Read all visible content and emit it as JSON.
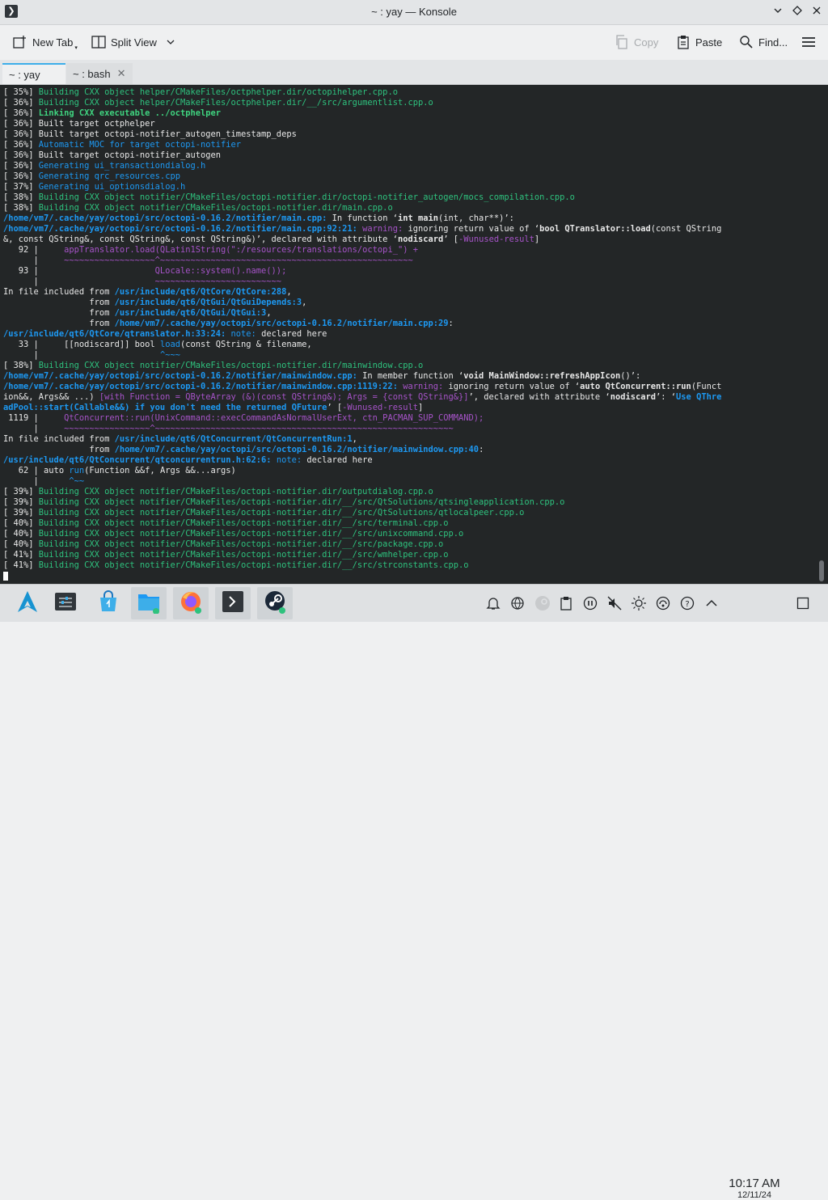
{
  "window": {
    "title": "~ : yay — Konsole"
  },
  "toolbar": {
    "new_tab": "New Tab",
    "split_view": "Split View",
    "copy": "Copy",
    "paste": "Paste",
    "find": "Find..."
  },
  "tabs": [
    {
      "label": "~ : yay",
      "active": true
    },
    {
      "label": "~ : bash",
      "active": false
    }
  ],
  "colors": {
    "terminal_bg": "#232627",
    "green": "#2ec27e",
    "bold_green": "#3fd37f",
    "blue": "#1d99f3",
    "purple": "#a653c8",
    "yellow": "#fdbc4b",
    "white": "#e8e8e8",
    "accent": "#3daee9"
  },
  "terminal": {
    "lines": [
      [
        [
          "[ 35%] ",
          "w"
        ],
        [
          "Building CXX object helper/CMakeFiles/octphelper.dir/octopihelper.cpp.o",
          "g"
        ]
      ],
      [
        [
          "[ 36%] ",
          "w"
        ],
        [
          "Building CXX object helper/CMakeFiles/octphelper.dir/__/src/argumentlist.cpp.o",
          "g"
        ]
      ],
      [
        [
          "[ 36%] ",
          "w"
        ],
        [
          "Linking CXX executable ../octphelper",
          "G"
        ]
      ],
      [
        [
          "[ 36%] Built target octphelper",
          "w"
        ]
      ],
      [
        [
          "[ 36%] Built target octopi-notifier_autogen_timestamp_deps",
          "w"
        ]
      ],
      [
        [
          "[ 36%] ",
          "w"
        ],
        [
          "Automatic MOC for target octopi-notifier",
          "b"
        ]
      ],
      [
        [
          "[ 36%] Built target octopi-notifier_autogen",
          "w"
        ]
      ],
      [
        [
          "[ 36%] ",
          "w"
        ],
        [
          "Generating ui_transactiondialog.h",
          "b"
        ]
      ],
      [
        [
          "[ 36%] ",
          "w"
        ],
        [
          "Generating qrc_resources.cpp",
          "b"
        ]
      ],
      [
        [
          "[ 37%] ",
          "w"
        ],
        [
          "Generating ui_optionsdialog.h",
          "b"
        ]
      ],
      [
        [
          "[ 38%] ",
          "w"
        ],
        [
          "Building CXX object notifier/CMakeFiles/octopi-notifier.dir/octopi-notifier_autogen/mocs_compilation.cpp.o",
          "g"
        ]
      ],
      [
        [
          "[ 38%] ",
          "w"
        ],
        [
          "Building CXX object notifier/CMakeFiles/octopi-notifier.dir/main.cpp.o",
          "g"
        ]
      ],
      [
        [
          "/home/vm7/.cache/yay/octopi/src/octopi-0.16.2/notifier/main.cpp:",
          "B"
        ],
        [
          " In function ‘",
          "w"
        ],
        [
          "int main",
          "W"
        ],
        [
          "(int, char**)’:",
          "w"
        ]
      ],
      [
        [
          "/home/vm7/.cache/yay/octopi/src/octopi-0.16.2/notifier/main.cpp:92:21: ",
          "B"
        ],
        [
          "warning: ",
          "p"
        ],
        [
          "ignoring return value of ‘",
          "w"
        ],
        [
          "bool QTranslator::load",
          "W"
        ],
        [
          "(const QString",
          "w"
        ]
      ],
      [
        [
          "&, const QString&, const QString&, const QString&)’, declared with attribute ‘",
          "w"
        ],
        [
          "nodiscard",
          "W"
        ],
        [
          "’ [",
          "w"
        ],
        [
          "-Wunused-result",
          "p"
        ],
        [
          "]",
          "w"
        ]
      ],
      [
        [
          "   92 |     ",
          "w"
        ],
        [
          "appTranslator.load(QLatin1String(\":/resources/translations/octopi_\") +",
          "p"
        ]
      ],
      [
        [
          "      |     ",
          "w"
        ],
        [
          "~~~~~~~~~~~~~~~~~~^~~~~~~~~~~~~~~~~~~~~~~~~~~~~~~~~~~~~~~~~~~~~~~~~~~",
          "p"
        ]
      ],
      [
        [
          "   93 |                       ",
          "w"
        ],
        [
          "QLocale::system().name());",
          "p"
        ]
      ],
      [
        [
          "      |                       ",
          "w"
        ],
        [
          "~~~~~~~~~~~~~~~~~~~~~~~~~",
          "p"
        ]
      ],
      [
        [
          "In file included from ",
          "w"
        ],
        [
          "/usr/include/qt6/QtCore/QtCore:288",
          "B"
        ],
        [
          ",",
          "w"
        ]
      ],
      [
        [
          "                 from ",
          "w"
        ],
        [
          "/usr/include/qt6/QtGui/QtGuiDepends:3",
          "B"
        ],
        [
          ",",
          "w"
        ]
      ],
      [
        [
          "                 from ",
          "w"
        ],
        [
          "/usr/include/qt6/QtGui/QtGui:3",
          "B"
        ],
        [
          ",",
          "w"
        ]
      ],
      [
        [
          "                 from ",
          "w"
        ],
        [
          "/home/vm7/.cache/yay/octopi/src/octopi-0.16.2/notifier/main.cpp:29",
          "B"
        ],
        [
          ":",
          "w"
        ]
      ],
      [
        [
          "/usr/include/qt6/QtCore/qtranslator.h:33:24: ",
          "B"
        ],
        [
          "note: ",
          "b"
        ],
        [
          "declared here",
          "w"
        ]
      ],
      [
        [
          "   33 |     [[nodiscard]] bool ",
          "w"
        ],
        [
          "load",
          "b"
        ],
        [
          "(const QString & filename,",
          "w"
        ]
      ],
      [
        [
          "      |                        ",
          "w"
        ],
        [
          "^~~~",
          "b"
        ]
      ],
      [
        [
          "[ 38%] ",
          "w"
        ],
        [
          "Building CXX object notifier/CMakeFiles/octopi-notifier.dir/mainwindow.cpp.o",
          "g"
        ]
      ],
      [
        [
          "/home/vm7/.cache/yay/octopi/src/octopi-0.16.2/notifier/mainwindow.cpp:",
          "B"
        ],
        [
          " In member function ‘",
          "w"
        ],
        [
          "void MainWindow::refreshAppIcon",
          "W"
        ],
        [
          "()’:",
          "w"
        ]
      ],
      [
        [
          "/home/vm7/.cache/yay/octopi/src/octopi-0.16.2/notifier/mainwindow.cpp:1119:22: ",
          "B"
        ],
        [
          "warning: ",
          "p"
        ],
        [
          "ignoring return value of ‘",
          "w"
        ],
        [
          "auto QtConcurrent::run",
          "W"
        ],
        [
          "(Funct",
          "w"
        ]
      ],
      [
        [
          "ion&&, Args&& ...) ",
          "w"
        ],
        [
          "[with Function = QByteArray (&)(const QString&); Args = {const QString&}]",
          "p"
        ],
        [
          "’, declared with attribute ‘",
          "w"
        ],
        [
          "nodiscard",
          "W"
        ],
        [
          "’: ‘",
          "w"
        ],
        [
          "Use QThre",
          "B"
        ]
      ],
      [
        [
          "adPool::start(Callable&&) if you don't need the returned QFuture",
          "B"
        ],
        [
          "’ [",
          "w"
        ],
        [
          "-Wunused-result",
          "p"
        ],
        [
          "]",
          "w"
        ]
      ],
      [
        [
          " 1119 |     ",
          "w"
        ],
        [
          "QtConcurrent::run(UnixCommand::execCommandAsNormalUserExt, ctn_PACMAN_SUP_COMMAND);",
          "p"
        ]
      ],
      [
        [
          "      |     ",
          "w"
        ],
        [
          "~~~~~~~~~~~~~~~~~^~~~~~~~~~~~~~~~~~~~~~~~~~~~~~~~~~~~~~~~~~~~~~~~~~~~~~~~~~~~",
          "p"
        ]
      ],
      [
        [
          "In file included from ",
          "w"
        ],
        [
          "/usr/include/qt6/QtConcurrent/QtConcurrentRun:1",
          "B"
        ],
        [
          ",",
          "w"
        ]
      ],
      [
        [
          "                 from ",
          "w"
        ],
        [
          "/home/vm7/.cache/yay/octopi/src/octopi-0.16.2/notifier/mainwindow.cpp:40",
          "B"
        ],
        [
          ":",
          "w"
        ]
      ],
      [
        [
          "/usr/include/qt6/QtConcurrent/qtconcurrentrun.h:62:6: ",
          "B"
        ],
        [
          "note: ",
          "b"
        ],
        [
          "declared here",
          "w"
        ]
      ],
      [
        [
          "   62 | auto ",
          "w"
        ],
        [
          "run",
          "b"
        ],
        [
          "(Function &&f, Args &&...args)",
          "w"
        ]
      ],
      [
        [
          "      |      ",
          "w"
        ],
        [
          "^~~",
          "b"
        ]
      ],
      [
        [
          "[ 39%] ",
          "w"
        ],
        [
          "Building CXX object notifier/CMakeFiles/octopi-notifier.dir/outputdialog.cpp.o",
          "g"
        ]
      ],
      [
        [
          "[ 39%] ",
          "w"
        ],
        [
          "Building CXX object notifier/CMakeFiles/octopi-notifier.dir/__/src/QtSolutions/qtsingleapplication.cpp.o",
          "g"
        ]
      ],
      [
        [
          "[ 39%] ",
          "w"
        ],
        [
          "Building CXX object notifier/CMakeFiles/octopi-notifier.dir/__/src/QtSolutions/qtlocalpeer.cpp.o",
          "g"
        ]
      ],
      [
        [
          "[ 40%] ",
          "w"
        ],
        [
          "Building CXX object notifier/CMakeFiles/octopi-notifier.dir/__/src/terminal.cpp.o",
          "g"
        ]
      ],
      [
        [
          "[ 40%] ",
          "w"
        ],
        [
          "Building CXX object notifier/CMakeFiles/octopi-notifier.dir/__/src/unixcommand.cpp.o",
          "g"
        ]
      ],
      [
        [
          "[ 40%] ",
          "w"
        ],
        [
          "Building CXX object notifier/CMakeFiles/octopi-notifier.dir/__/src/package.cpp.o",
          "g"
        ]
      ],
      [
        [
          "[ 41%] ",
          "w"
        ],
        [
          "Building CXX object notifier/CMakeFiles/octopi-notifier.dir/__/src/wmhelper.cpp.o",
          "g"
        ]
      ],
      [
        [
          "[ 41%] ",
          "w"
        ],
        [
          "Building CXX object notifier/CMakeFiles/octopi-notifier.dir/__/src/strconstants.cpp.o",
          "g"
        ]
      ]
    ]
  },
  "taskbar": {
    "apps": [
      {
        "icon": "arch-linux-launcher-icon",
        "running": false
      },
      {
        "icon": "system-settings-icon",
        "running": false
      },
      {
        "icon": "discover-store-icon",
        "running": false
      },
      {
        "icon": "dolphin-folder-icon",
        "running": true
      },
      {
        "icon": "firefox-icon",
        "running": true
      },
      {
        "icon": "konsole-terminal-icon",
        "running": true
      },
      {
        "icon": "steam-icon",
        "running": true
      }
    ],
    "clock_time": "10:17 AM",
    "clock_date": "12/11/24"
  }
}
